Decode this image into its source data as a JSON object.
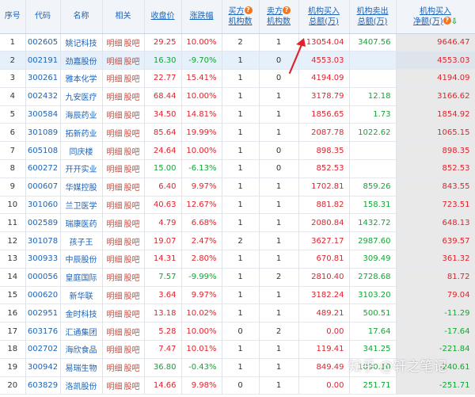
{
  "headers": {
    "seq": "序号",
    "code": "代码",
    "name": "名称",
    "related": "相关",
    "close": "收盘价",
    "change": "涨跌幅",
    "buy_count": [
      "买方",
      "机构数"
    ],
    "sell_count": [
      "卖方",
      "机构数"
    ],
    "buy_total": [
      "机构买入",
      "总额(万)"
    ],
    "sell_total": [
      "机构卖出",
      "总额(万)"
    ],
    "net": [
      "机构买入",
      "净额(万)"
    ]
  },
  "link_detail": "明细",
  "link_forum": "股吧",
  "colors": {
    "up": "#e0232b",
    "down": "#12a633",
    "link": "#1b63b8",
    "help_badge": "#f07623"
  },
  "icons": {
    "help": "question-icon",
    "sort": "sort-down-arrow-icon",
    "annotation": "red-arrow-annotation"
  },
  "watermark": "知乎 @轩之笔记",
  "rows": [
    {
      "seq": "1",
      "code": "002605",
      "name": "姚记科技",
      "close": "29.25",
      "change": "10.00%",
      "buyn": "2",
      "selln": "1",
      "buy": "13054.04",
      "sell": "3407.56",
      "net": "9646.47"
    },
    {
      "seq": "2",
      "code": "002191",
      "name": "劲嘉股份",
      "close": "16.30",
      "change": "-9.70%",
      "buyn": "1",
      "selln": "0",
      "buy": "4553.03",
      "sell": "",
      "net": "4553.03"
    },
    {
      "seq": "3",
      "code": "300261",
      "name": "雅本化学",
      "close": "22.77",
      "change": "15.41%",
      "buyn": "1",
      "selln": "0",
      "buy": "4194.09",
      "sell": "",
      "net": "4194.09"
    },
    {
      "seq": "4",
      "code": "002432",
      "name": "九安医疗",
      "close": "68.44",
      "change": "10.00%",
      "buyn": "1",
      "selln": "1",
      "buy": "3178.79",
      "sell": "12.18",
      "net": "3166.62"
    },
    {
      "seq": "5",
      "code": "300584",
      "name": "海辰药业",
      "close": "34.50",
      "change": "14.81%",
      "buyn": "1",
      "selln": "1",
      "buy": "1856.65",
      "sell": "1.73",
      "net": "1854.92"
    },
    {
      "seq": "6",
      "code": "301089",
      "name": "拓新药业",
      "close": "85.64",
      "change": "19.99%",
      "buyn": "1",
      "selln": "1",
      "buy": "2087.78",
      "sell": "1022.62",
      "net": "1065.15"
    },
    {
      "seq": "7",
      "code": "605108",
      "name": "同庆楼",
      "close": "24.64",
      "change": "10.00%",
      "buyn": "1",
      "selln": "0",
      "buy": "898.35",
      "sell": "",
      "net": "898.35"
    },
    {
      "seq": "8",
      "code": "600272",
      "name": "开开实业",
      "close": "15.00",
      "change": "-6.13%",
      "buyn": "1",
      "selln": "0",
      "buy": "852.53",
      "sell": "",
      "net": "852.53"
    },
    {
      "seq": "9",
      "code": "000607",
      "name": "华媒控股",
      "close": "6.40",
      "change": "9.97%",
      "buyn": "1",
      "selln": "1",
      "buy": "1702.81",
      "sell": "859.26",
      "net": "843.55"
    },
    {
      "seq": "10",
      "code": "301060",
      "name": "兰卫医学",
      "close": "40.63",
      "change": "12.67%",
      "buyn": "1",
      "selln": "1",
      "buy": "881.82",
      "sell": "158.31",
      "net": "723.51"
    },
    {
      "seq": "11",
      "code": "002589",
      "name": "瑞康医药",
      "close": "4.79",
      "change": "6.68%",
      "buyn": "1",
      "selln": "1",
      "buy": "2080.84",
      "sell": "1432.72",
      "net": "648.13"
    },
    {
      "seq": "12",
      "code": "301078",
      "name": "孩子王",
      "close": "19.07",
      "change": "2.47%",
      "buyn": "2",
      "selln": "1",
      "buy": "3627.17",
      "sell": "2987.60",
      "net": "639.57"
    },
    {
      "seq": "13",
      "code": "300933",
      "name": "中辰股份",
      "close": "14.31",
      "change": "2.80%",
      "buyn": "1",
      "selln": "1",
      "buy": "670.81",
      "sell": "309.49",
      "net": "361.32"
    },
    {
      "seq": "14",
      "code": "000056",
      "name": "皇庭国际",
      "close": "7.57",
      "change": "-9.99%",
      "buyn": "1",
      "selln": "2",
      "buy": "2810.40",
      "sell": "2728.68",
      "net": "81.72"
    },
    {
      "seq": "15",
      "code": "000620",
      "name": "新华联",
      "close": "3.64",
      "change": "9.97%",
      "buyn": "1",
      "selln": "1",
      "buy": "3182.24",
      "sell": "3103.20",
      "net": "79.04"
    },
    {
      "seq": "16",
      "code": "002951",
      "name": "金时科技",
      "close": "13.18",
      "change": "10.02%",
      "buyn": "1",
      "selln": "1",
      "buy": "489.21",
      "sell": "500.51",
      "net": "-11.29"
    },
    {
      "seq": "17",
      "code": "603176",
      "name": "汇通集团",
      "close": "5.28",
      "change": "10.00%",
      "buyn": "0",
      "selln": "2",
      "buy": "0.00",
      "sell": "17.64",
      "net": "-17.64"
    },
    {
      "seq": "18",
      "code": "002702",
      "name": "海欣食品",
      "close": "7.47",
      "change": "10.01%",
      "buyn": "1",
      "selln": "1",
      "buy": "119.41",
      "sell": "341.25",
      "net": "-221.84"
    },
    {
      "seq": "19",
      "code": "300942",
      "name": "易瑞生物",
      "close": "36.80",
      "change": "-0.43%",
      "buyn": "1",
      "selln": "1",
      "buy": "849.49",
      "sell": "1090.10",
      "net": "-240.61"
    },
    {
      "seq": "20",
      "code": "603829",
      "name": "洛凯股份",
      "close": "14.66",
      "change": "9.98%",
      "buyn": "0",
      "selln": "1",
      "buy": "0.00",
      "sell": "251.71",
      "net": "-251.71"
    }
  ]
}
